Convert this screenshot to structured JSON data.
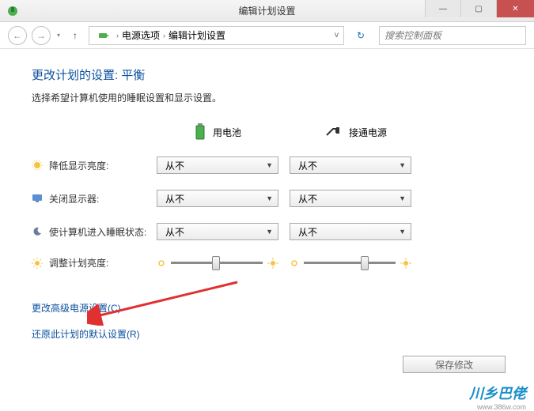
{
  "window": {
    "title": "编辑计划设置",
    "controls": {
      "min": "—",
      "max": "▢",
      "close": "✕"
    }
  },
  "nav": {
    "back": "←",
    "forward": "→",
    "history": "▾",
    "up": "↑",
    "breadcrumb": {
      "item1": "电源选项",
      "item2": "编辑计划设置",
      "sep": "›"
    },
    "addressDropdown": "v",
    "refresh": "↻",
    "searchPlaceholder": "搜索控制面板"
  },
  "page": {
    "heading": "更改计划的设置: 平衡",
    "subheading": "选择希望计算机使用的睡眠设置和显示设置。",
    "colBattery": "用电池",
    "colPlugged": "接通电源",
    "rows": {
      "dim": {
        "label": "降低显示亮度:",
        "battery": "从不",
        "plugged": "从不"
      },
      "off": {
        "label": "关闭显示器:",
        "battery": "从不",
        "plugged": "从不"
      },
      "sleep": {
        "label": "使计算机进入睡眠状态:",
        "battery": "从不",
        "plugged": "从不"
      },
      "bright": {
        "label": "调整计划亮度:"
      }
    },
    "links": {
      "advanced": "更改高级电源设置(C)",
      "restore": "还原此计划的默认设置(R)"
    },
    "footerBtn": "保存修改"
  },
  "watermark": {
    "logo": "川乡巴佬",
    "url": "www.386w.com"
  }
}
